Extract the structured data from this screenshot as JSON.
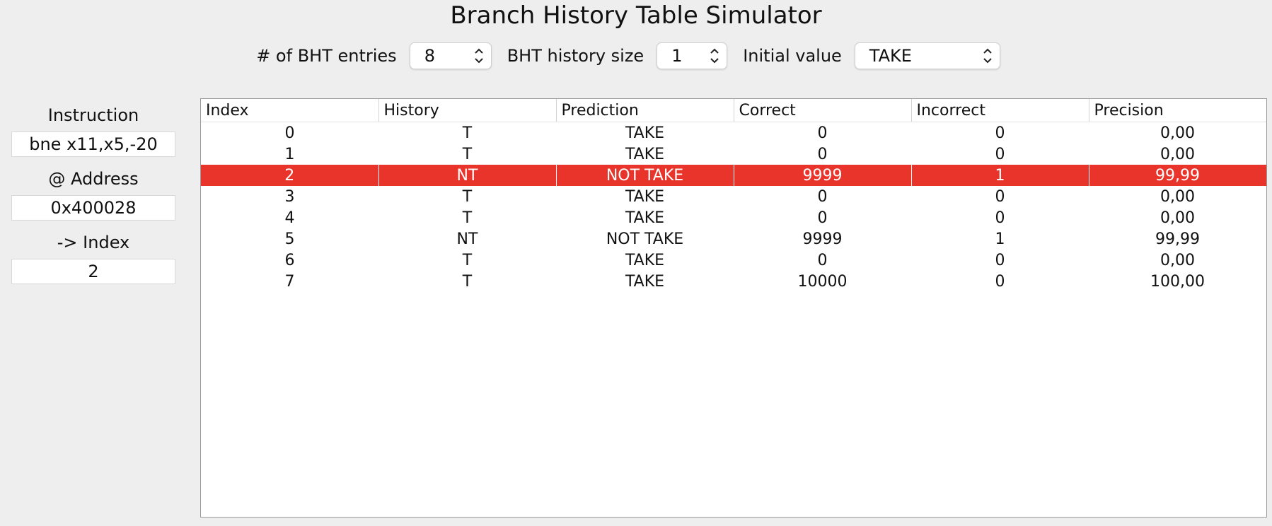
{
  "title": "Branch History Table Simulator",
  "controls": {
    "entries_label": "# of BHT entries",
    "entries_value": "8",
    "history_label": "BHT history size",
    "history_value": "1",
    "initial_label": "Initial value",
    "initial_value": "TAKE"
  },
  "left_panel": {
    "instruction_label": "Instruction",
    "instruction_value": "bne x11,x5,-20",
    "address_label": "@ Address",
    "address_value": "0x400028",
    "index_label": "-> Index",
    "index_value": "2"
  },
  "table": {
    "headers": [
      "Index",
      "History",
      "Prediction",
      "Correct",
      "Incorrect",
      "Precision"
    ],
    "rows": [
      [
        "0",
        "T",
        "TAKE",
        "0",
        "0",
        "0,00"
      ],
      [
        "1",
        "T",
        "TAKE",
        "0",
        "0",
        "0,00"
      ],
      [
        "2",
        "NT",
        "NOT TAKE",
        "9999",
        "1",
        "99,99"
      ],
      [
        "3",
        "T",
        "TAKE",
        "0",
        "0",
        "0,00"
      ],
      [
        "4",
        "T",
        "TAKE",
        "0",
        "0",
        "0,00"
      ],
      [
        "5",
        "NT",
        "NOT TAKE",
        "9999",
        "1",
        "99,99"
      ],
      [
        "6",
        "T",
        "TAKE",
        "0",
        "0",
        "0,00"
      ],
      [
        "7",
        "T",
        "TAKE",
        "10000",
        "0",
        "100,00"
      ]
    ],
    "selected_row": 2,
    "highlight_color": "#e8342a"
  }
}
